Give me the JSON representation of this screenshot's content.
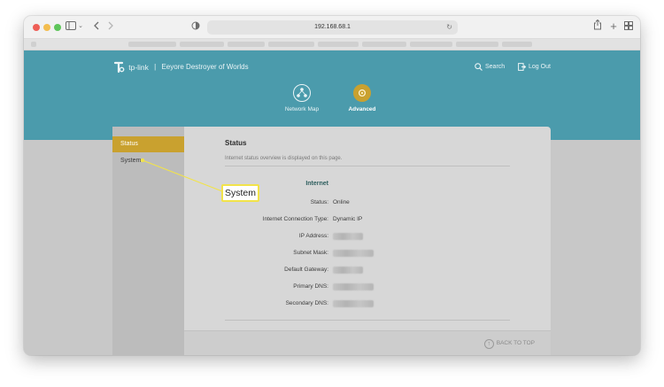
{
  "browser": {
    "url": "192.168.68.1"
  },
  "header": {
    "brand": "tp-link",
    "separator": "|",
    "router_name": "Eeyore Destroyer of Worlds",
    "search_label": "Search",
    "logout_label": "Log Out",
    "tabs": [
      {
        "label": "Network Map",
        "active": false
      },
      {
        "label": "Advanced",
        "active": true
      }
    ]
  },
  "sidebar": {
    "items": [
      {
        "label": "Status",
        "active": true
      },
      {
        "label": "System",
        "active": false
      }
    ]
  },
  "content": {
    "title": "Status",
    "description": "Internet status overview is displayed on this page.",
    "section": "Internet",
    "fields": [
      {
        "label": "Status:",
        "value": "Online"
      },
      {
        "label": "Internet Connection Type:",
        "value": "Dynamic IP"
      },
      {
        "label": "IP Address:",
        "value": ""
      },
      {
        "label": "Subnet Mask:",
        "value": ""
      },
      {
        "label": "Default Gateway:",
        "value": ""
      },
      {
        "label": "Primary DNS:",
        "value": ""
      },
      {
        "label": "Secondary DNS:",
        "value": ""
      }
    ],
    "back_to_top": "BACK TO TOP"
  },
  "annotation": {
    "label": "System"
  },
  "colors": {
    "header": "#4b9bac",
    "accent": "#c9a12f",
    "callout": "#f2e34a"
  }
}
